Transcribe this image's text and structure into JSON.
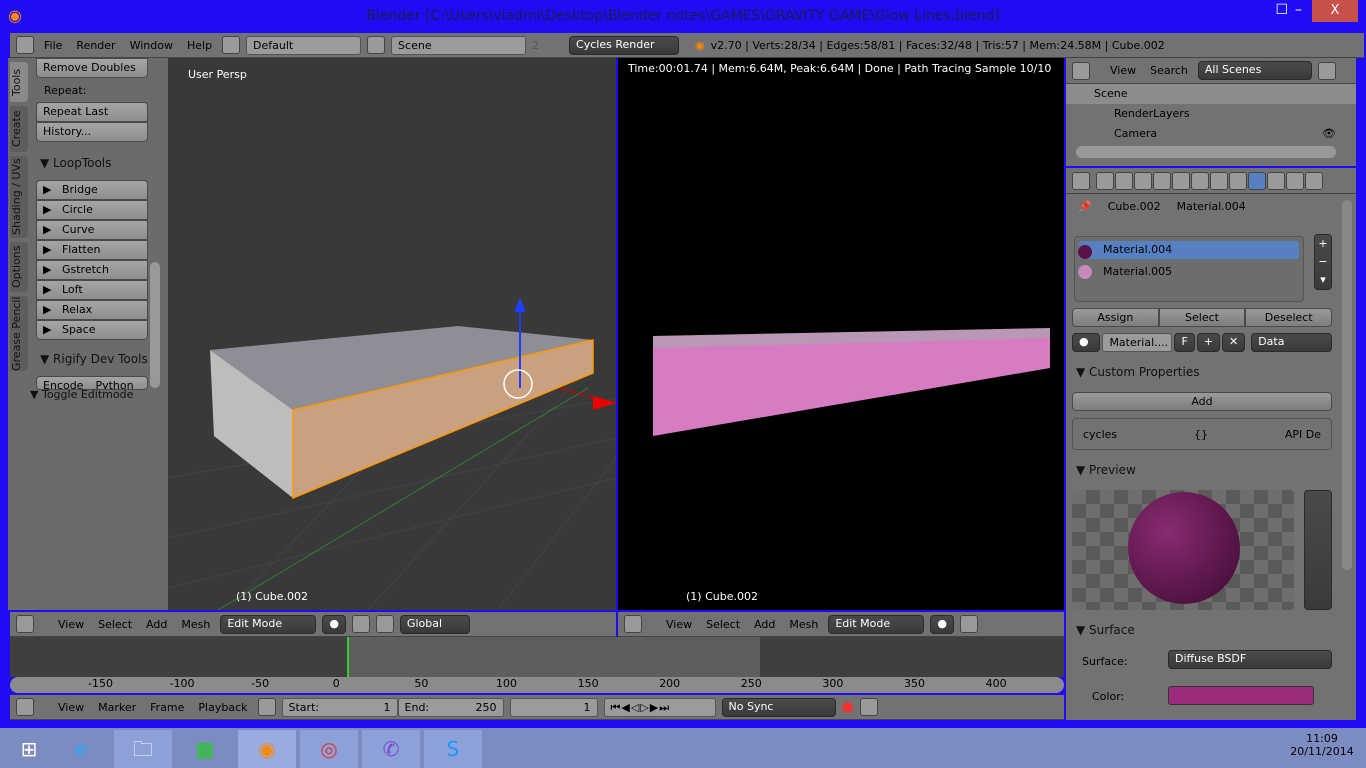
{
  "window": {
    "title": "Blender [C:\\Users\\vladmi\\Desktop\\Blender notes\\GAMES\\GRAVITY GAME\\Glow Lines.blend]",
    "close": "X",
    "min": "–",
    "max": "☐"
  },
  "info_header": {
    "menus": [
      "File",
      "Render",
      "Window",
      "Help"
    ],
    "layout": "Default",
    "scene": "Scene",
    "scene_users": "2",
    "engine": "Cycles Render",
    "stats": "v2.70 | Verts:28/34 | Edges:58/81 | Faces:32/48 | Tris:57 | Mem:24.58M | Cube.002"
  },
  "tool_shelf": {
    "tabs": [
      "Tools",
      "Create",
      "Shading / UVs",
      "Options",
      "Grease Pencil"
    ],
    "remove_doubles": "Remove Doubles",
    "repeat_label": "Repeat:",
    "repeat_last": "Repeat Last",
    "history": "History...",
    "looptools_title": "LoopTools",
    "looptools": [
      "Bridge",
      "Circle",
      "Curve",
      "Flatten",
      "Gstretch",
      "Loft",
      "Relax",
      "Space"
    ],
    "rigify_title": "Rigify Dev Tools",
    "encode": "Encode",
    "python": "Python",
    "toggle_editmode": "Toggle Editmode"
  },
  "viewport_left": {
    "label": "User Persp",
    "object": "(1) Cube.002"
  },
  "viewport_right": {
    "status": "Time:00:01.74 | Mem:6.64M, Peak:6.64M | Done | Path Tracing Sample 10/10",
    "object": "(1) Cube.002"
  },
  "view3d_header": {
    "menus": [
      "View",
      "Select",
      "Add",
      "Mesh"
    ],
    "mode": "Edit Mode",
    "orientation": "Global"
  },
  "timeline": {
    "ruler": [
      "-150",
      "-100",
      "-50",
      "0",
      "50",
      "100",
      "150",
      "200",
      "250",
      "300",
      "350",
      "400"
    ],
    "current_frame_value": 0,
    "menus": [
      "View",
      "Marker",
      "Frame",
      "Playback"
    ],
    "start_label": "Start:",
    "start": "1",
    "end_label": "End:",
    "end": "250",
    "frame": "1",
    "sync": "No Sync"
  },
  "outliner": {
    "menus": [
      "View",
      "Search"
    ],
    "filter": "All Scenes",
    "items": [
      "Scene",
      "RenderLayers",
      "Camera"
    ]
  },
  "properties": {
    "breadcrumb": [
      "Cube.002",
      "Material.004"
    ],
    "materials": [
      "Material.004",
      "Material.005"
    ],
    "assign": "Assign",
    "select": "Select",
    "deselect": "Deselect",
    "material_name": "Material....",
    "fake": "F",
    "link": "Data",
    "custom_props_title": "Custom Properties",
    "add": "Add",
    "prop_name": "cycles",
    "prop_value": "{}",
    "prop_api": "API De",
    "preview_title": "Preview",
    "surface_title": "Surface",
    "surface_label": "Surface:",
    "surface_value": "Diffuse BSDF",
    "color_label": "Color:",
    "color_value": "#9a2b7d"
  },
  "taskbar": {
    "time": "11:09",
    "date": "20/11/2014"
  }
}
